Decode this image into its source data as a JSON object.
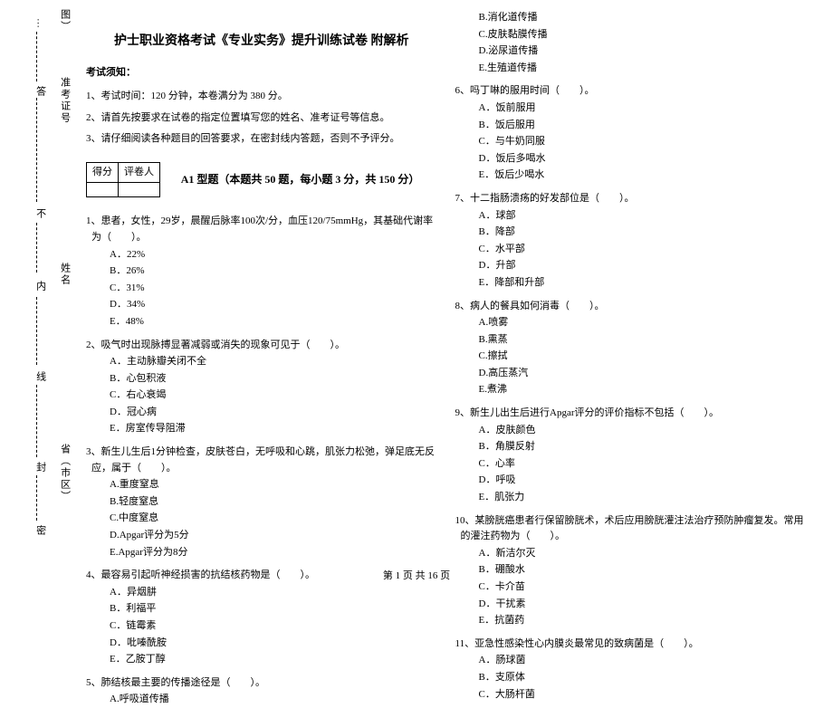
{
  "binding": {
    "corner": "图）",
    "ticket_label": "准考证号",
    "name_label": "姓名",
    "region_label": "省（市区）",
    "seal_chars": [
      "答",
      "不",
      "内",
      "线",
      "封",
      "密"
    ],
    "extra_char": "…"
  },
  "header": {
    "title": "护士职业资格考试《专业实务》提升训练试卷 附解析",
    "notice_label": "考试须知：",
    "instructions": [
      "1、考试时间：120 分钟，本卷满分为 380 分。",
      "2、请首先按要求在试卷的指定位置填写您的姓名、准考证号等信息。",
      "3、请仔细阅读各种题目的回答要求，在密封线内答题，否则不予评分。"
    ],
    "score_cells": [
      "得分",
      "评卷人"
    ],
    "section_heading": "A1 型题（本题共 50 题，每小题 3 分，共 150 分）"
  },
  "questions_left": [
    {
      "stem": "1、患者，女性，29岁，晨醒后脉率100次/分，血压120/75mmHg，其基础代谢率为（　　）。",
      "options": [
        "A．22%",
        "B．26%",
        "C．31%",
        "D．34%",
        "E．48%"
      ]
    },
    {
      "stem": "2、吸气时出现脉搏显著减弱或消失的现象可见于（　　）。",
      "options": [
        "A．主动脉瓣关闭不全",
        "B．心包积液",
        "C．右心衰竭",
        "D．冠心病",
        "E．房室传导阻滞"
      ]
    },
    {
      "stem": "3、新生儿生后1分钟检查，皮肤苍白，无呼吸和心跳，肌张力松弛，弹足底无反应，属于（　　）。",
      "options": [
        "A.重度窒息",
        "B.轻度窒息",
        "C.中度窒息",
        "D.Apgar评分为5分",
        "E.Apgar评分为8分"
      ]
    },
    {
      "stem": "4、最容易引起听神经损害的抗结核药物是（　　）。",
      "options": [
        "A．异烟肼",
        "B．利福平",
        "C．链霉素",
        "D．吡嗪酰胺",
        "E．乙胺丁醇"
      ]
    },
    {
      "stem": "5、肺结核最主要的传播途径是（　　）。",
      "options": [
        "A.呼吸道传播"
      ]
    }
  ],
  "questions_right_pre": [
    "B.消化道传播",
    "C.皮肤黏膜传播",
    "D.泌尿道传播",
    "E.生殖道传播"
  ],
  "questions_right": [
    {
      "stem": "6、吗丁啉的服用时间（　　）。",
      "options": [
        "A．饭前服用",
        "B．饭后服用",
        "C．与牛奶同服",
        "D．饭后多喝水",
        "E．饭后少喝水"
      ]
    },
    {
      "stem": "7、十二指肠溃疡的好发部位是（　　）。",
      "options": [
        "A．球部",
        "B．降部",
        "C．水平部",
        "D．升部",
        "E．降部和升部"
      ]
    },
    {
      "stem": "8、病人的餐具如何消毒（　　）。",
      "options": [
        "A.喷雾",
        "B.熏蒸",
        "C.擦拭",
        "D.高压蒸汽",
        "E.煮沸"
      ]
    },
    {
      "stem": "9、新生儿出生后进行Apgar评分的评价指标不包括（　　）。",
      "options": [
        "A．皮肤颜色",
        "B．角膜反射",
        "C．心率",
        "D．呼吸",
        "E．肌张力"
      ]
    },
    {
      "stem": "10、某膀胱癌患者行保留膀胱术，术后应用膀胱灌注法治疗预防肿瘤复发。常用的灌注药物为（　　）。",
      "options": [
        "A．新洁尔灭",
        "B．硼酸水",
        "C．卡介苗",
        "D．干扰素",
        "E．抗菌药"
      ]
    },
    {
      "stem": "11、亚急性感染性心内膜炎最常见的致病菌是（　　）。",
      "options": [
        "A．肠球菌",
        "B．支原体",
        "C．大肠杆菌"
      ]
    }
  ],
  "footer": "第 1 页 共 16 页"
}
